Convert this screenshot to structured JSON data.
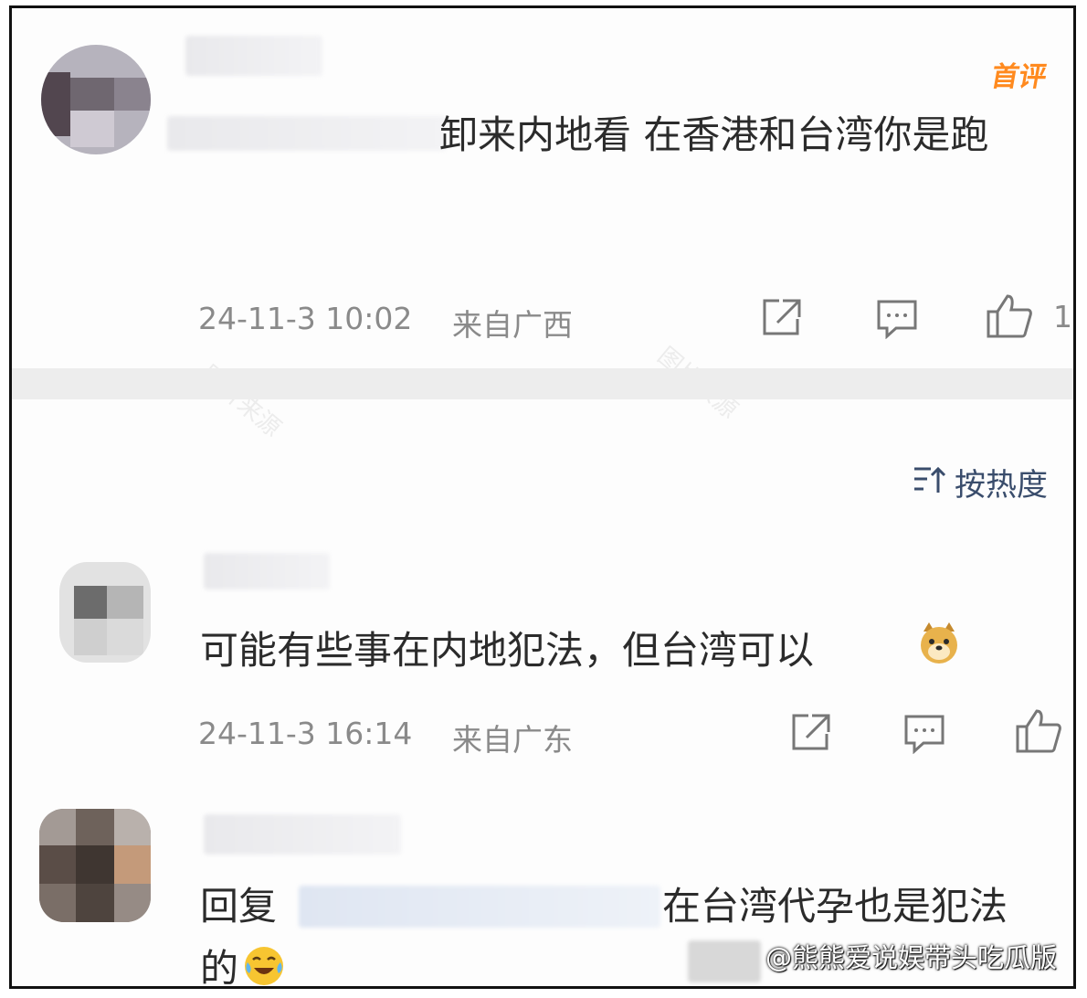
{
  "comments": [
    {
      "text": "卸来内地看 在香港和台湾你是跑",
      "badge": "首评",
      "timestamp": "24-11-3 10:02",
      "location": "来自广西",
      "like_count": "1"
    },
    {
      "text": "可能有些事在内地犯法，但台湾可以",
      "timestamp": "24-11-3 16:14",
      "location": "来自广东"
    },
    {
      "reply_prefix": "回复",
      "text": "在台湾代孕也是犯法",
      "text_cont": "的"
    }
  ],
  "sort": {
    "label": "按热度"
  },
  "watermark": "@熊熊爱说娱带头吃瓜版",
  "colors": {
    "accent": "#ff8a1f",
    "sort": "#3a4d6c",
    "meta": "#8a8a8a"
  },
  "icons": [
    "share-icon",
    "comment-icon",
    "like-icon",
    "sort-icon",
    "doge-emoji",
    "laugh-cry-emoji"
  ]
}
